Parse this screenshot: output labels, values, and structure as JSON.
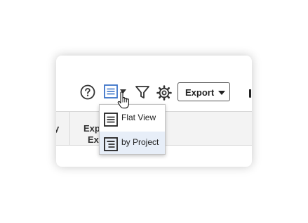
{
  "toolbar": {
    "help_icon": "question-circle-icon",
    "view_switch_icon": "list-view-icon",
    "filter_icon": "filter-icon",
    "settings_icon": "gear-icon",
    "export_label": "Export",
    "accent_color": "#3b73c8"
  },
  "grid": {
    "columns": [
      {
        "line1": "y",
        "line2": ""
      },
      {
        "line1": "Exp",
        "line2": "Ex"
      }
    ]
  },
  "view_menu": {
    "items": [
      {
        "label": "Flat View",
        "icon": "flat-list-icon",
        "selected": false
      },
      {
        "label": "by Project",
        "icon": "grouped-list-icon",
        "selected": true
      }
    ],
    "highlight_color": "#e7eef8"
  }
}
